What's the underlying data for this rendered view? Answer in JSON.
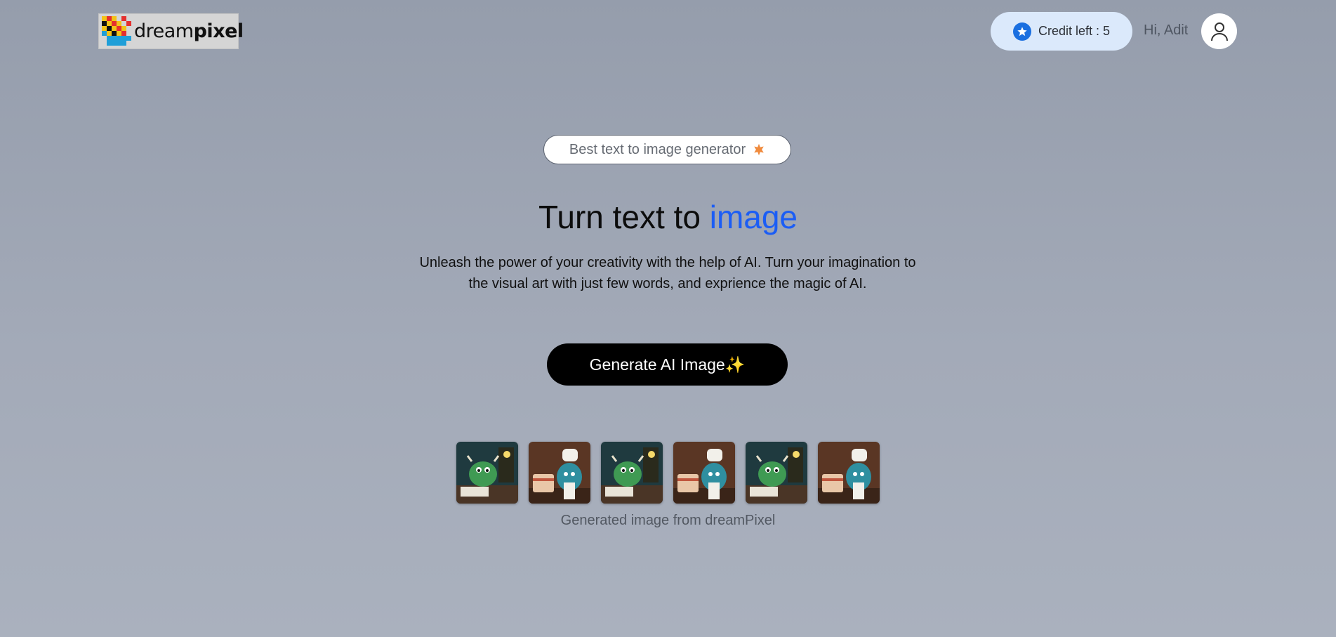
{
  "header": {
    "logo": {
      "text_light": "dream",
      "text_bold": "pixel"
    },
    "credits_label": "Credit left : 5",
    "credits_icon": "star-icon",
    "greeting": "Hi, Adit",
    "avatar_icon": "user-icon"
  },
  "hero": {
    "tag": "Best text to image generator",
    "tag_icon": "sparkle-icon",
    "title_main": "Turn text to",
    "title_accent": "image",
    "description": "Unleash the power of your creativity with the help of AI. Turn your imagination to the visual art with just few words, and exprience the magic of AI.",
    "cta_label": "Generate AI Image✨"
  },
  "gallery": {
    "images": [
      {
        "alt": "green monster reading"
      },
      {
        "alt": "blue monster chef with cake"
      },
      {
        "alt": "green monster reading"
      },
      {
        "alt": "blue monster chef with cake"
      },
      {
        "alt": "green monster reading"
      },
      {
        "alt": "blue monster chef with cake"
      }
    ],
    "caption": "Generated image from dreamPixel"
  },
  "colors": {
    "accent": "#1b5df5",
    "credit_bg": "#dbe9fb",
    "star_badge": "#1a6fe0",
    "cta_bg": "#000000"
  }
}
